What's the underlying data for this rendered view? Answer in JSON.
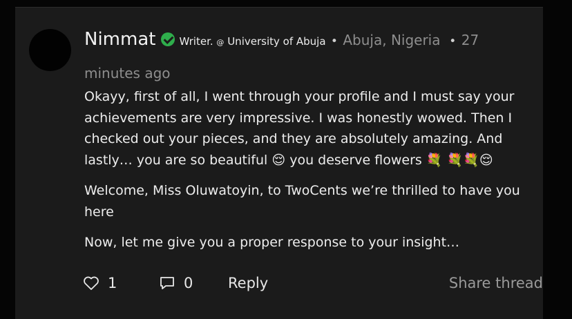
{
  "post": {
    "author": "Nimmat",
    "role_prefix": "Writer.",
    "at_symbol": "@",
    "institution": "University of Abuja",
    "location": "Abuja, Nigeria",
    "time_ago": "27 minutes ago",
    "paragraphs": [
      "Okayy, first of all, I went through your profile and I must say your achievements are very impressive. I was honestly wowed. Then I checked out your pieces, and they are absolutely amazing. And lastly… you are so beautiful",
      "you deserve flowers"
    ],
    "emoji_relieved": "😌",
    "emoji_flowers": "💐 💐💐",
    "paragraph2": "Welcome, Miss Oluwatoyin, to TwoCents we’re thrilled to have you here",
    "paragraph3": "Now, let me give you a proper response to your insight…"
  },
  "actions": {
    "like_count": "1",
    "comment_count": "0",
    "reply_label": "Reply",
    "share_label": "Share thread"
  },
  "icons": {
    "verified": "verified-check-icon",
    "like": "heart-outline-icon",
    "comment": "speech-bubble-icon"
  },
  "colors": {
    "background": "#050505",
    "card": "#1b1b1b",
    "verified": "#2fae4c",
    "muted_text": "#8e8e8e"
  }
}
